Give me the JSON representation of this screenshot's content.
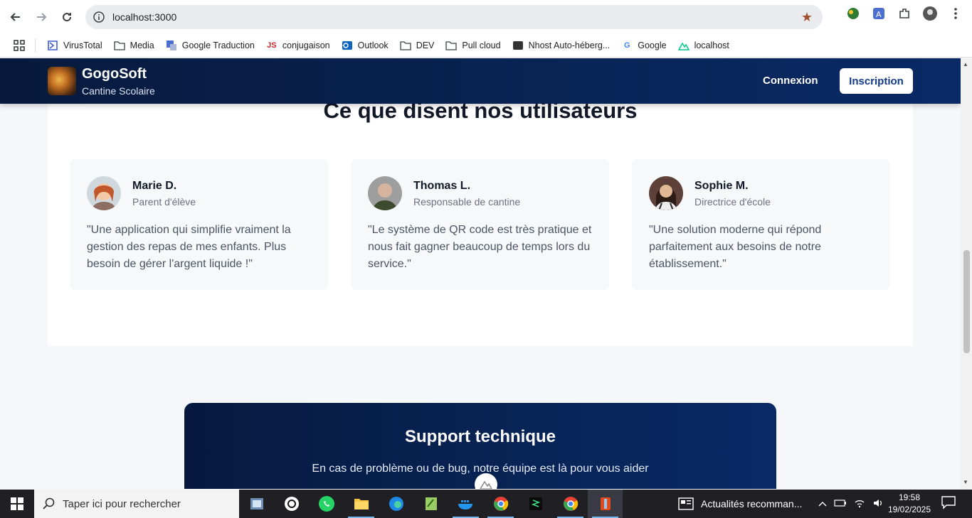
{
  "browser": {
    "url": "localhost:3000",
    "bookmarks": [
      {
        "label": "VirusTotal",
        "icon": "virustotal-icon"
      },
      {
        "label": "Media",
        "icon": "folder-icon"
      },
      {
        "label": "Google Traduction",
        "icon": "google-translate-icon"
      },
      {
        "label": "conjugaison",
        "icon": "conjugaison-icon"
      },
      {
        "label": "Outlook",
        "icon": "outlook-icon"
      },
      {
        "label": "DEV",
        "icon": "folder-icon"
      },
      {
        "label": "Pull cloud",
        "icon": "folder-icon"
      },
      {
        "label": "Nhost Auto-héberg...",
        "icon": "nhost-icon"
      },
      {
        "label": "Google",
        "icon": "google-icon"
      },
      {
        "label": "localhost",
        "icon": "nuxt-icon"
      }
    ]
  },
  "header": {
    "brand": "GogoSoft",
    "subtitle": "Cantine Scolaire",
    "login": "Connexion",
    "signup": "Inscription"
  },
  "testimonials": {
    "title": "Ce que disent nos utilisateurs",
    "items": [
      {
        "name": "Marie D.",
        "role": "Parent d'élève",
        "quote": "\"Une application qui simplifie vraiment la gestion des repas de mes enfants. Plus besoin de gérer l'argent liquide !\""
      },
      {
        "name": "Thomas L.",
        "role": "Responsable de cantine",
        "quote": "\"Le système de QR code est très pratique et nous fait gagner beaucoup de temps lors du service.\""
      },
      {
        "name": "Sophie M.",
        "role": "Directrice d'école",
        "quote": "\"Une solution moderne qui répond parfaitement aux besoins de notre établissement.\""
      }
    ]
  },
  "support": {
    "title": "Support technique",
    "subtitle": "En cas de problème ou de bug, notre équipe est là pour vous aider"
  },
  "taskbar": {
    "search_placeholder": "Taper ici pour rechercher",
    "news": "Actualités recomman...",
    "time": "19:58",
    "date": "19/02/2025"
  },
  "colors": {
    "header_bg": "#071a3d",
    "accent": "#123a8a"
  }
}
